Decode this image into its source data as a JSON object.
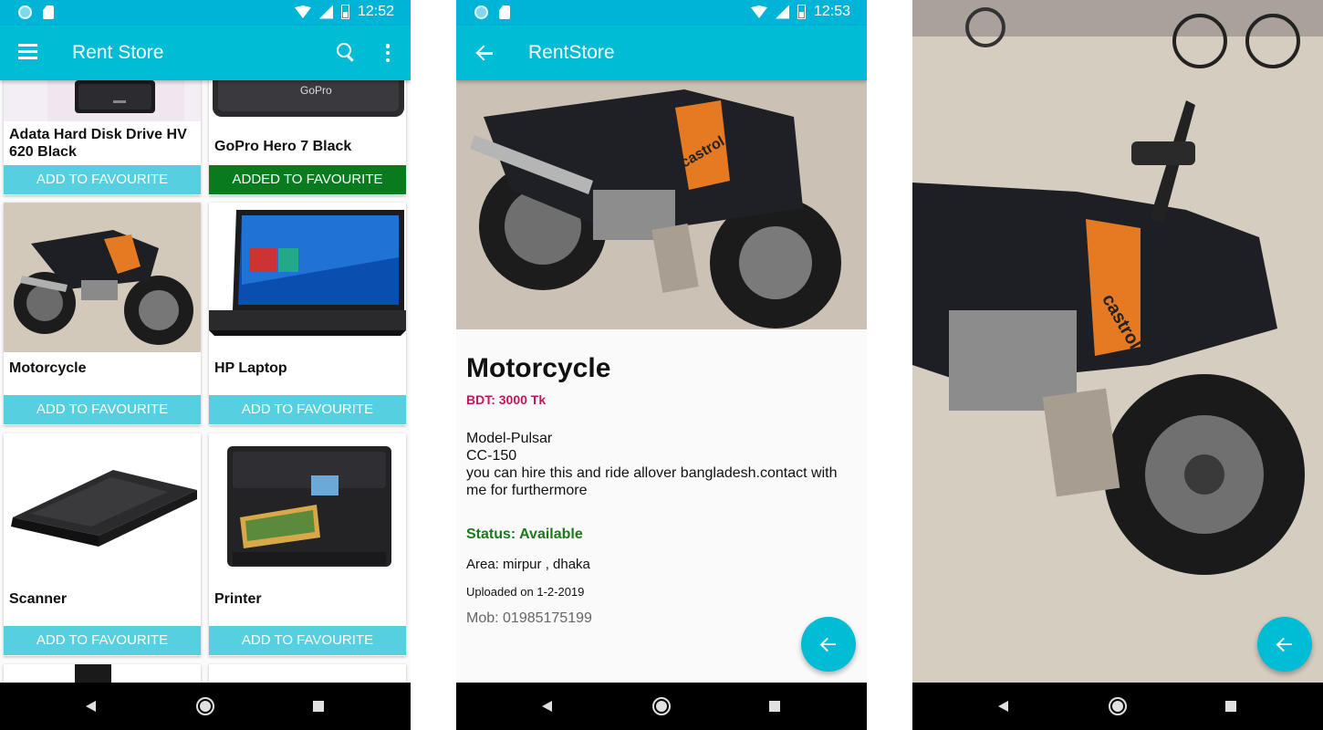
{
  "screens": {
    "list": {
      "status_time": "12:52",
      "app_title": "Rent Store",
      "products": [
        {
          "name": "Adata Hard Disk Drive HV 620 Black",
          "favourite_label": "ADD TO FAVOURITE",
          "favourited": false,
          "image": "hard-disk-image"
        },
        {
          "name": "GoPro Hero 7 Black",
          "favourite_label": "ADDED TO FAVOURITE",
          "favourited": true,
          "image": "gopro-camera-image"
        },
        {
          "name": "Motorcycle",
          "favourite_label": "ADD TO FAVOURITE",
          "favourited": false,
          "image": "motorcycle-image"
        },
        {
          "name": "HP Laptop",
          "favourite_label": "ADD TO FAVOURITE",
          "favourited": false,
          "image": "laptop-image"
        },
        {
          "name": "Scanner",
          "favourite_label": "ADD TO FAVOURITE",
          "favourited": false,
          "image": "scanner-image"
        },
        {
          "name": "Printer",
          "favourite_label": "ADD TO FAVOURITE",
          "favourited": false,
          "image": "printer-image"
        }
      ],
      "gopro_logo": "GoPro"
    },
    "detail": {
      "status_time": "12:53",
      "app_title": "RentStore",
      "title": "Motorcycle",
      "price": "BDT: 3000 Tk",
      "description": [
        "Model-Pulsar",
        "CC-150",
        "you can hire this and ride allover bangladesh.contact with me for furthermore"
      ],
      "status": "Status: Available",
      "area": "Area: mirpur , dhaka",
      "uploaded": "Uploaded on 1-2-2019",
      "mobile": "Mob: 01985175199",
      "bike_decal": "castrol"
    },
    "fullimage": {
      "image": "motorcycle-photo"
    }
  },
  "colors": {
    "primary": "#00bcd4",
    "fav_button": "#56cfe1",
    "fav_button_active": "#0a7a1f",
    "price": "#c2185b",
    "status": "#1b7a1b"
  },
  "icons": [
    "menu-icon",
    "search-icon",
    "more-vert-icon",
    "back-arrow-icon",
    "fab-back-icon",
    "nav-back-icon",
    "nav-home-icon",
    "nav-recent-icon"
  ]
}
